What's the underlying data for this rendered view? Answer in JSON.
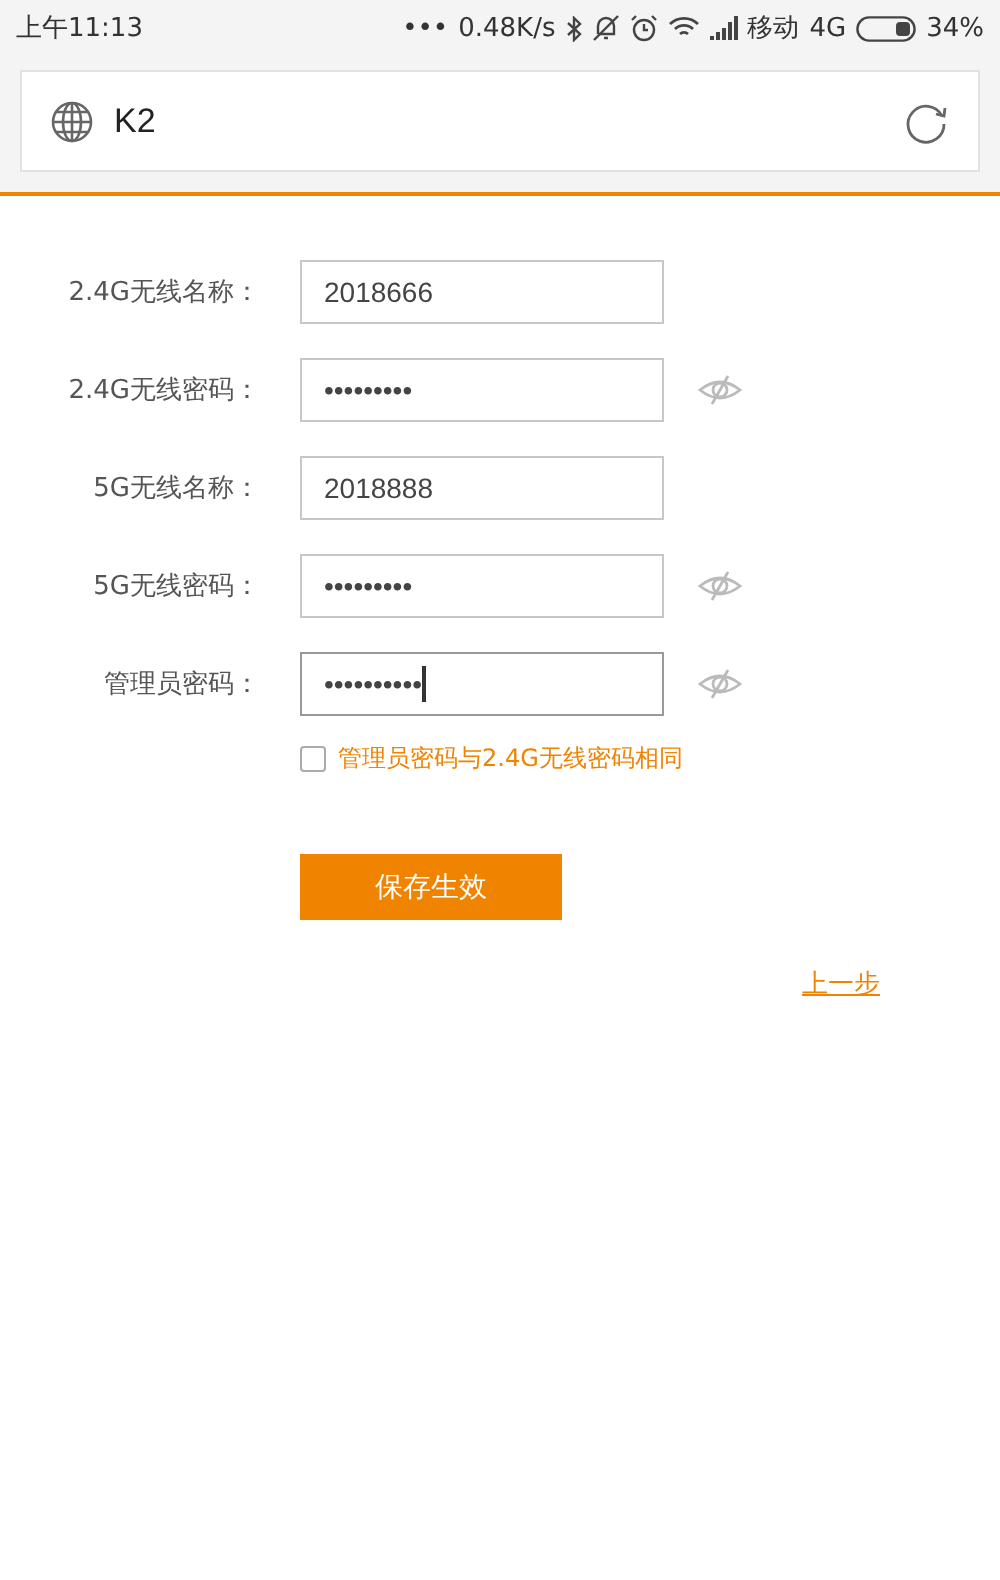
{
  "status_bar": {
    "time": "上午11:13",
    "more": "•••",
    "speed": "0.48K/s",
    "carrier": "移动",
    "network": "4G",
    "battery": "34%"
  },
  "address_bar": {
    "url": "K2"
  },
  "fields": [
    {
      "label": "2.4G无线名称：",
      "kind": "text",
      "value": "2018666",
      "focused": false
    },
    {
      "label": "2.4G无线密码：",
      "kind": "password",
      "value": "•••••••••",
      "focused": false
    },
    {
      "label": "5G无线名称：",
      "kind": "text",
      "value": "2018888",
      "focused": false
    },
    {
      "label": "5G无线密码：",
      "kind": "password",
      "value": "•••••••••",
      "focused": false
    },
    {
      "label": "管理员密码：",
      "kind": "password",
      "value": "••••••••••",
      "focused": true
    }
  ],
  "same_password": {
    "label": "管理员密码与2.4G无线密码相同",
    "checked": false
  },
  "save_button": "保存生效",
  "back_link": "上一步"
}
